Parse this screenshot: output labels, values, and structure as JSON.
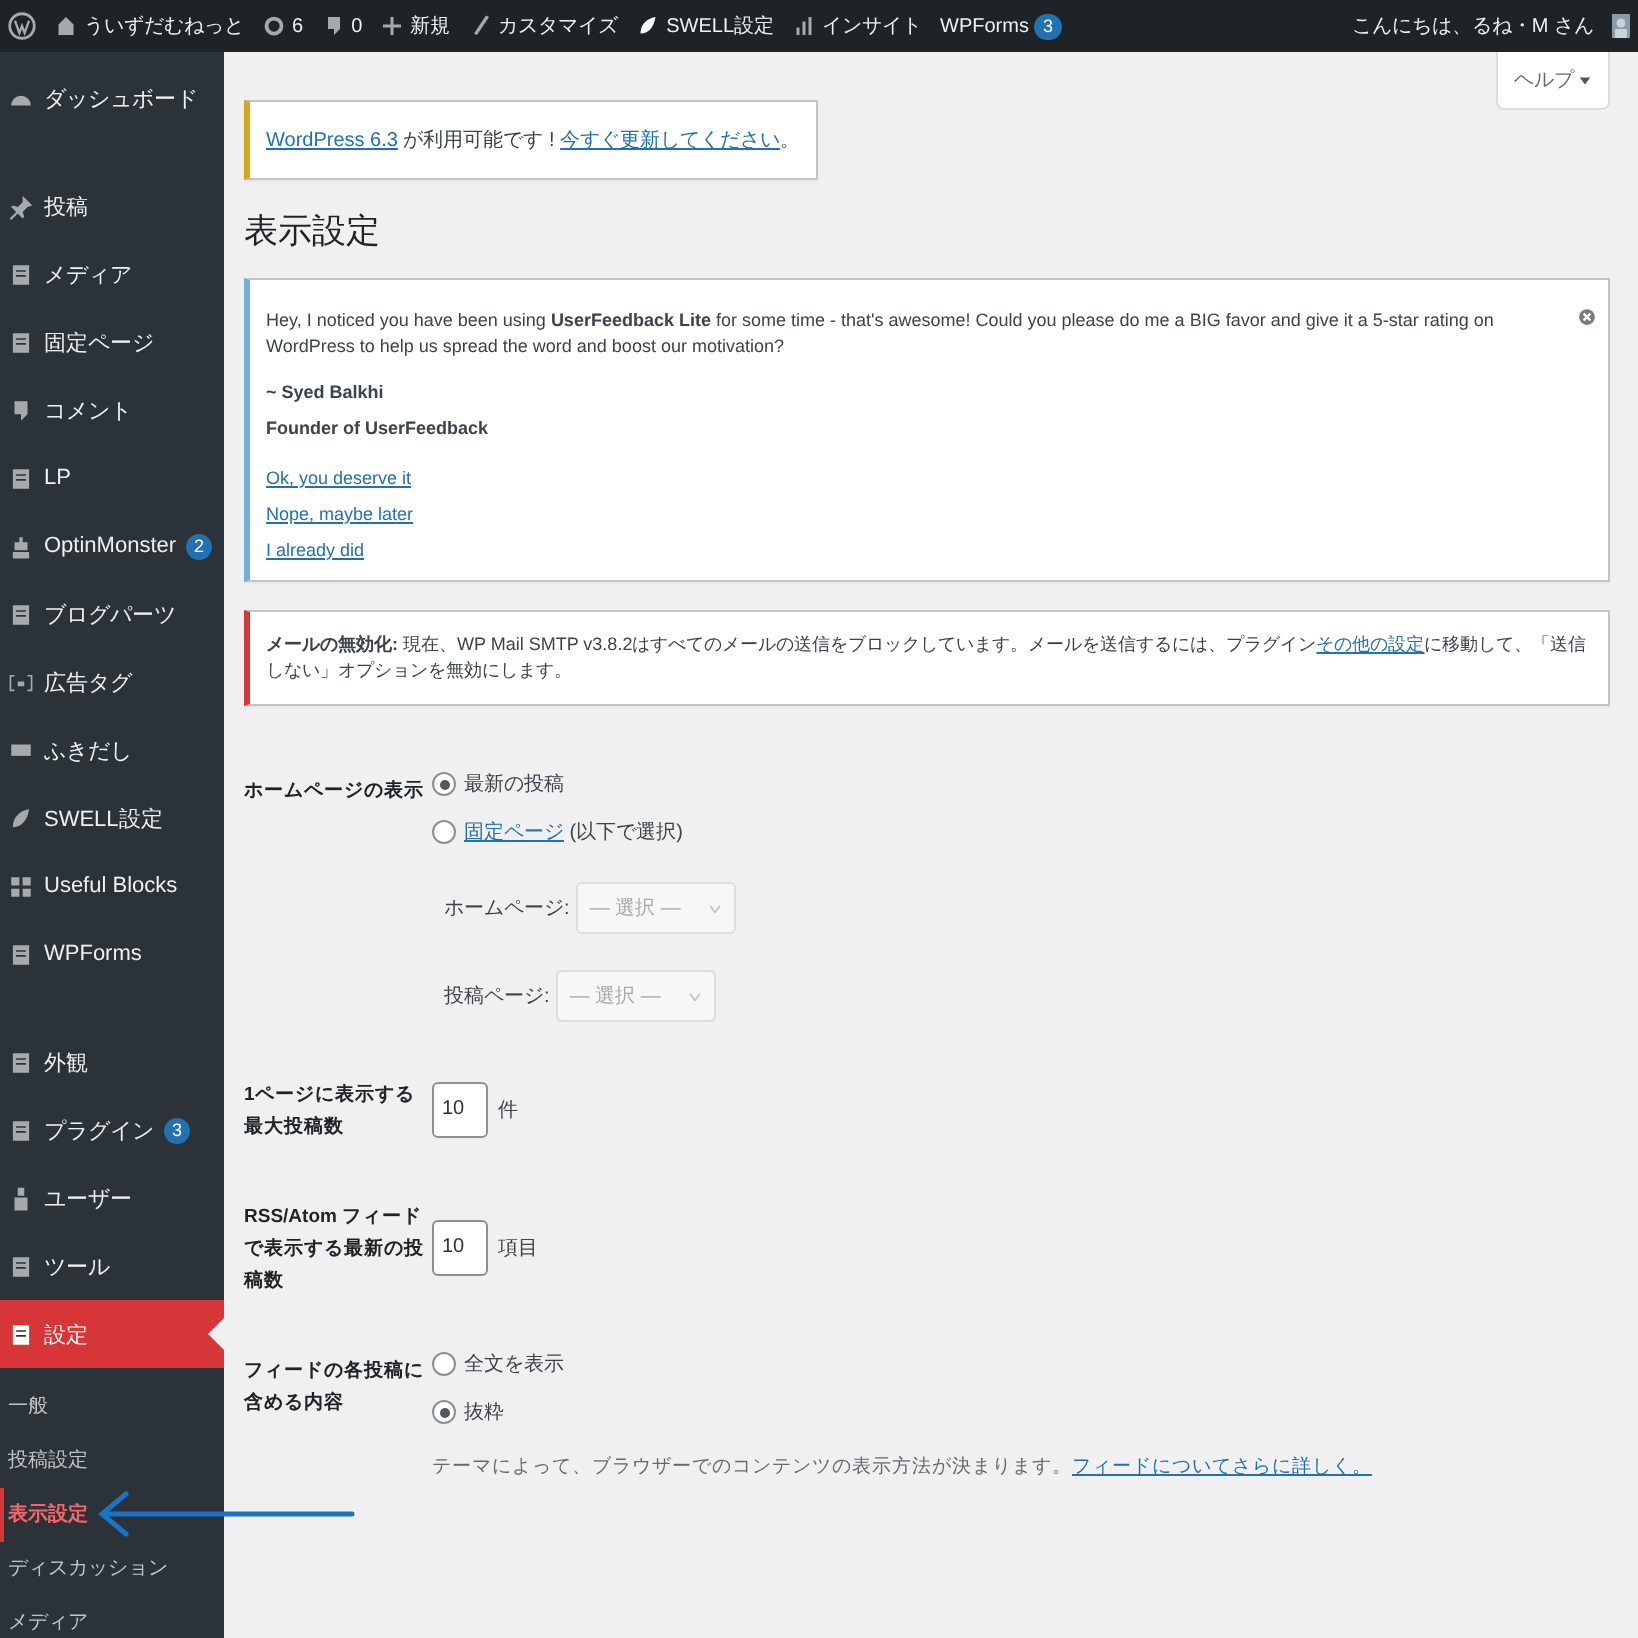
{
  "admin_bar": {
    "items": [
      {
        "label": "ういずだむねっと"
      },
      {
        "label": "6"
      },
      {
        "label": "0"
      },
      {
        "label": "新規"
      },
      {
        "label": "カスタマイズ"
      },
      {
        "label": "SWELL設定"
      },
      {
        "label": "インサイト"
      },
      {
        "label": "WPForms",
        "badge": "3"
      }
    ],
    "greeting": "こんにちは、るね・M さん"
  },
  "sidebar": {
    "groups": [
      [
        {
          "label": "ダッシュボード",
          "selected": false
        }
      ],
      [
        {
          "label": "投稿",
          "selected": false
        },
        {
          "label": "メディア",
          "selected": false
        },
        {
          "label": "固定ページ",
          "selected": false
        },
        {
          "label": "コメント",
          "selected": false
        },
        {
          "label": "LP",
          "selected": false
        },
        {
          "label": "OptinMonster",
          "selected": false,
          "badge": "2"
        },
        {
          "label": "ブログパーツ",
          "selected": false
        },
        {
          "label": "広告タグ",
          "selected": false
        },
        {
          "label": "ふきだし",
          "selected": false
        },
        {
          "label": "SWELL設定",
          "selected": false
        },
        {
          "label": "Useful Blocks",
          "selected": false
        },
        {
          "label": "WPForms",
          "selected": false
        }
      ],
      [
        {
          "label": "外観",
          "selected": false
        },
        {
          "label": "プラグイン",
          "selected": false,
          "badge": "3"
        },
        {
          "label": "ユーザー",
          "selected": false
        },
        {
          "label": "ツール",
          "selected": false
        },
        {
          "label": "設定",
          "selected": true,
          "children": [
            {
              "label": "一般",
              "selected": false
            },
            {
              "label": "投稿設定",
              "selected": false
            },
            {
              "label": "表示設定",
              "selected": true
            },
            {
              "label": "ディスカッション",
              "selected": false
            },
            {
              "label": "メディア",
              "selected": false
            }
          ]
        }
      ]
    ]
  },
  "help_button": "ヘルプ",
  "update_notice": {
    "parts": [
      {
        "text": "WordPress 6.3",
        "link": true
      },
      {
        "text": " が利用可能です ! ",
        "link": false
      },
      {
        "text": "今すぐ更新してください",
        "link": true
      },
      {
        "text": "。",
        "link": false
      }
    ]
  },
  "page_title": "表示設定",
  "feedback_notice": {
    "message": "Hey, I noticed you have been using **UserFeedback Lite** for some time - that's awesome! Could you please do me a BIG favor and give it a 5-star rating on WordPress to help us spread the word and boost our motivation?",
    "signature": [
      "~ Syed Balkhi",
      "Founder of UserFeedback"
    ],
    "links": [
      "Ok, you deserve it",
      "Nope, maybe later",
      "I already did"
    ]
  },
  "mail_notice": {
    "parts": [
      {
        "text": "**メールの無効化:** 現在、WP Mail SMTP v3.8.2はすべてのメールの送信をブロックしています。メールを送信するには、プラグイン",
        "link": false
      },
      {
        "text": "その他の設定",
        "link": true
      },
      {
        "text": "に移動して、「送信しない」オプションを無効にします。",
        "link": false
      }
    ]
  },
  "settings": {
    "homepage": {
      "label": "ホームページの表示",
      "options": [
        {
          "parts": [
            {
              "text": "最新の投稿",
              "link": false
            }
          ],
          "selected": true
        },
        {
          "parts": [
            {
              "text": "固定ページ",
              "link": true
            },
            {
              "text": " (以下で選択)",
              "link": false
            }
          ],
          "selected": false
        }
      ],
      "selects": [
        {
          "label": "ホームページ:",
          "value": "— 選択 —",
          "disabled": true
        },
        {
          "label": "投稿ページ:",
          "value": "— 選択 —",
          "disabled": true
        }
      ]
    },
    "posts_per_page": {
      "label": "1ページに表示する最大投稿数",
      "value": "10",
      "unit": "件"
    },
    "feed_items": {
      "label": "RSS/Atom フィードで表示する最新の投稿数",
      "value": "10",
      "unit": "項目"
    },
    "feed_content": {
      "label": "フィードの各投稿に含める内容",
      "options": [
        {
          "parts": [
            {
              "text": "全文を表示",
              "link": false
            }
          ],
          "selected": false
        },
        {
          "parts": [
            {
              "text": "抜粋",
              "link": false
            }
          ],
          "selected": true
        }
      ],
      "description": [
        {
          "text": "テーマによって、ブラウザーでのコンテンツの表示方法が決まります。",
          "link": false
        },
        {
          "text": "フィードについてさらに詳しく。",
          "link": true
        }
      ]
    }
  }
}
